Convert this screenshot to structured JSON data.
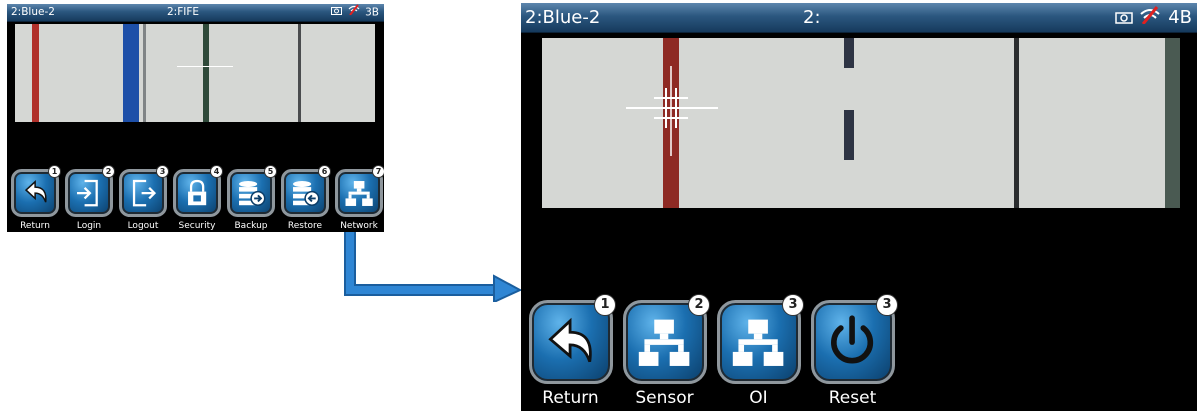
{
  "screen_small": {
    "title_left": "2:Blue-2",
    "title_center": "2:FIFE",
    "title_right": "3B",
    "status_icons": [
      "camera-icon",
      "no-wifi-icon"
    ],
    "buttons": [
      {
        "label": "Return",
        "badge": "1",
        "icon": "return-arrow-icon"
      },
      {
        "label": "Login",
        "badge": "2",
        "icon": "login-icon"
      },
      {
        "label": "Logout",
        "badge": "3",
        "icon": "logout-icon"
      },
      {
        "label": "Security",
        "badge": "4",
        "icon": "padlock-icon"
      },
      {
        "label": "Backup",
        "badge": "5",
        "icon": "backup-database-icon"
      },
      {
        "label": "Restore",
        "badge": "6",
        "icon": "restore-database-icon"
      },
      {
        "label": "Network",
        "badge": "7",
        "icon": "network-icon"
      }
    ]
  },
  "screen_large": {
    "title_left": "2:Blue-2",
    "title_center": "2:",
    "title_right": "4B",
    "status_icons": [
      "camera-icon",
      "no-wifi-icon"
    ],
    "buttons": [
      {
        "label": "Return",
        "badge": "1",
        "icon": "return-arrow-icon"
      },
      {
        "label": "Sensor",
        "badge": "2",
        "icon": "network-icon"
      },
      {
        "label": "OI",
        "badge": "3",
        "icon": "network-icon"
      },
      {
        "label": "Reset",
        "badge": "3",
        "icon": "power-icon"
      }
    ]
  },
  "colors": {
    "titlebar": "#2b577f",
    "button_blue": "#1b6fb0",
    "arrow": "#2f86d4",
    "red_line": "#b0302a",
    "blue_line": "#1d4fa8",
    "green_line": "#2f4a3a"
  }
}
